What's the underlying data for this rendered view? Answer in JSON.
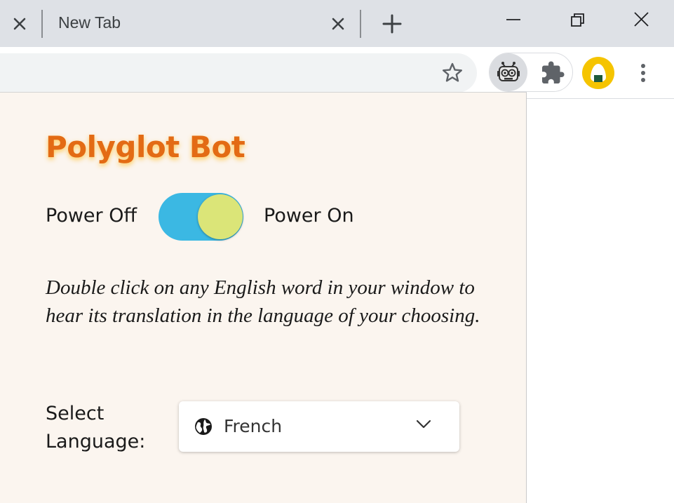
{
  "browser": {
    "tabs": [
      {
        "title": "New Tab"
      }
    ]
  },
  "popup": {
    "title": "Polyglot Bot",
    "power_off_label": "Power Off",
    "power_on_label": "Power On",
    "power_state": "on",
    "description": "Double click on any English word in your window to hear its translation in the language of your choosing.",
    "select_label": "Select Language:",
    "selected_language": "French"
  },
  "colors": {
    "title": "#e36b14",
    "toggle_track": "#3bb8e3",
    "toggle_knob": "#dbe578",
    "panel_bg": "#fbf5ef",
    "profile_avatar": "#f5c400"
  }
}
